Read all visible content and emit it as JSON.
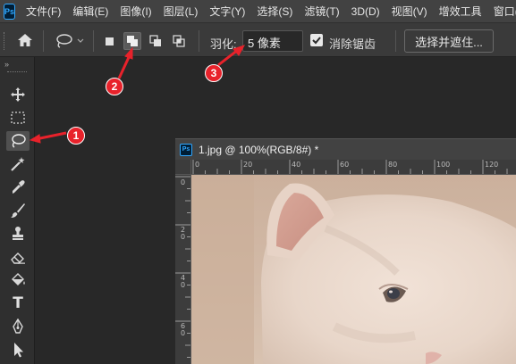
{
  "app": {
    "logo_text": "Ps"
  },
  "menu": [
    {
      "label": "文件(F)"
    },
    {
      "label": "编辑(E)"
    },
    {
      "label": "图像(I)"
    },
    {
      "label": "图层(L)"
    },
    {
      "label": "文字(Y)"
    },
    {
      "label": "选择(S)"
    },
    {
      "label": "滤镜(T)"
    },
    {
      "label": "3D(D)"
    },
    {
      "label": "视图(V)"
    },
    {
      "label": "增效工具"
    },
    {
      "label": "窗口(W)"
    }
  ],
  "options": {
    "feather_label": "羽化:",
    "feather_value": "5 像素",
    "antialias_label": "消除锯齿",
    "antialias_checked": true,
    "select_mask_label": "选择并遮住...",
    "active_mode": "add-to-selection"
  },
  "toolbar": {
    "collapse_glyph": "»",
    "tools": [
      {
        "name": "move-tool-icon"
      },
      {
        "name": "marquee-tool-icon"
      },
      {
        "name": "lasso-tool-icon",
        "active": true
      },
      {
        "name": "magic-wand-tool-icon"
      },
      {
        "name": "eyedropper-tool-icon"
      },
      {
        "name": "brush-tool-icon"
      },
      {
        "name": "stamp-tool-icon"
      },
      {
        "name": "eraser-tool-icon"
      },
      {
        "name": "paint-bucket-tool-icon"
      },
      {
        "name": "type-tool-icon",
        "glyph": "T"
      },
      {
        "name": "pen-tool-icon"
      },
      {
        "name": "path-selection-tool-icon"
      }
    ]
  },
  "document": {
    "title": "1.jpg @ 100%(RGB/8#) *",
    "icon_text": "Ps",
    "h_ruler": [
      "0",
      "20",
      "40",
      "60",
      "80",
      "100",
      "120"
    ],
    "v_ruler": [
      "0",
      "2\n0",
      "4\n0",
      "6\n0"
    ]
  },
  "callouts": [
    "1",
    "2",
    "3"
  ],
  "colors": {
    "accent_red": "#e8222b",
    "ps_blue": "#31a8ff",
    "menubar_bg": "#424242",
    "panel_bg": "#3a3a3a"
  }
}
